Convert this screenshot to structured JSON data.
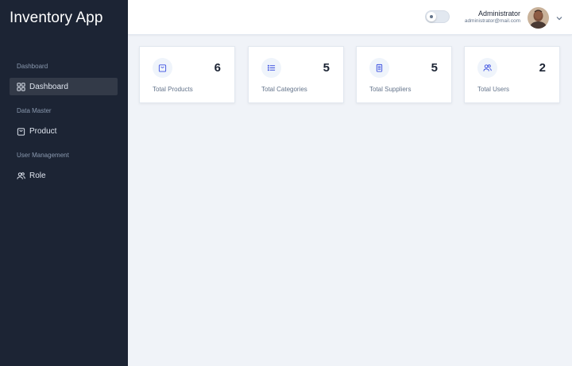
{
  "app": {
    "title": "Inventory App"
  },
  "sidebar": {
    "sections": [
      {
        "label": "Dashboard",
        "items": [
          {
            "label": "Dashboard",
            "icon": "grid-icon",
            "active": true
          }
        ]
      },
      {
        "label": "Data Master",
        "items": [
          {
            "label": "Product",
            "icon": "shopping-bag-icon",
            "active": false
          }
        ]
      },
      {
        "label": "User Management",
        "items": [
          {
            "label": "Role",
            "icon": "users-icon",
            "active": false
          }
        ]
      }
    ]
  },
  "header": {
    "user_name": "Administrator",
    "user_email": "administrator@mail.com",
    "dark_mode": false
  },
  "stats": [
    {
      "label": "Total Products",
      "value": "6",
      "icon": "shopping-bag-icon"
    },
    {
      "label": "Total Categories",
      "value": "5",
      "icon": "list-icon"
    },
    {
      "label": "Total Suppliers",
      "value": "5",
      "icon": "clipboard-icon"
    },
    {
      "label": "Total Users",
      "value": "2",
      "icon": "users-icon"
    }
  ],
  "colors": {
    "sidebar_bg": "#1c2434",
    "accent": "#3c50e0",
    "page_bg": "#f0f3f8"
  }
}
